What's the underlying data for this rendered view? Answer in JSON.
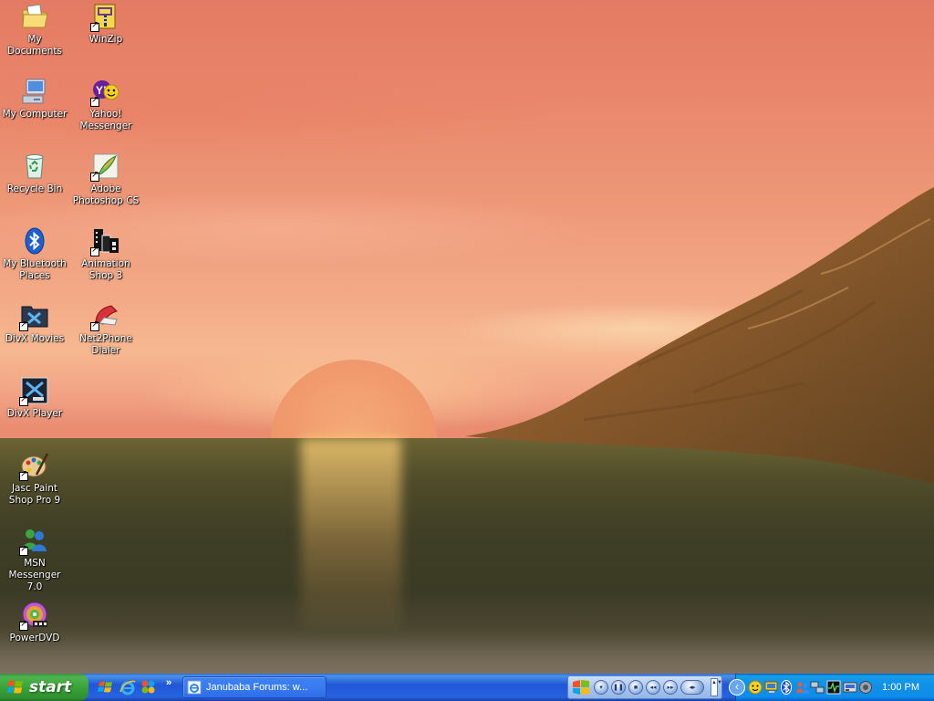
{
  "desktop": {
    "icons_left": [
      {
        "label": "My Documents"
      },
      {
        "label": "My Computer"
      },
      {
        "label": "Recycle Bin"
      },
      {
        "label": "My Bluetooth Places"
      },
      {
        "label": "DivX Movies"
      },
      {
        "label": "DivX Player"
      },
      {
        "label": "Jasc Paint Shop Pro 9"
      },
      {
        "label": "MSN Messenger 7.0"
      },
      {
        "label": "PowerDVD"
      }
    ],
    "icons_right": [
      {
        "label": "WinZip"
      },
      {
        "label": "Yahoo! Messenger"
      },
      {
        "label": "Adobe Photoshop CS"
      },
      {
        "label": "Animation Shop 3"
      },
      {
        "label": "Net2Phone Dialer"
      }
    ]
  },
  "taskbar": {
    "start_label": "start",
    "quick_launch": [
      "windows-logo-icon",
      "internet-explorer-icon",
      "msn-butterfly-icon"
    ],
    "overflow_label": "»",
    "tasks": [
      {
        "label": "Janubaba Forums: w...",
        "icon": "internet-explorer-icon"
      }
    ],
    "media_controls": [
      "menu",
      "play-pause",
      "stop",
      "previous",
      "next",
      "volume"
    ],
    "tray_icons": [
      "show-hidden-icon",
      "yahoo-tray-icon",
      "display-tray-icon",
      "bluetooth-tray-icon",
      "users-tray-icon",
      "network-tray-icon",
      "activity-tray-icon",
      "tool-tray-icon",
      "sound-tray-icon"
    ],
    "clock": "1:00 PM"
  },
  "colors": {
    "taskbar_blue": "#2157d7",
    "start_green": "#3aa33a",
    "tray_blue": "#1290e8"
  }
}
